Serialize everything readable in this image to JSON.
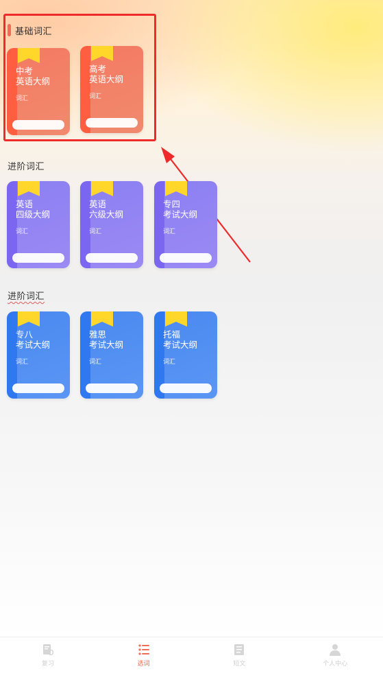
{
  "sections": [
    {
      "title": "基础词汇",
      "books": [
        {
          "name": "中考\n英语大纲",
          "sub": "词汇",
          "color": "orange"
        },
        {
          "name": "高考\n英语大纲",
          "sub": "词汇",
          "color": "orange"
        }
      ]
    },
    {
      "title": "进阶词汇",
      "books": [
        {
          "name": "英语\n四级大纲",
          "sub": "词汇",
          "color": "purple"
        },
        {
          "name": "英语\n六级大纲",
          "sub": "词汇",
          "color": "purple"
        },
        {
          "name": "专四\n考试大纲",
          "sub": "词汇",
          "color": "purple"
        }
      ]
    },
    {
      "title": "进阶词汇",
      "books": [
        {
          "name": "专八\n考试大纲",
          "sub": "词汇",
          "color": "blue"
        },
        {
          "name": "雅思\n考试大纲",
          "sub": "词汇",
          "color": "blue"
        },
        {
          "name": "托福\n考试大纲",
          "sub": "词汇",
          "color": "blue"
        }
      ]
    }
  ],
  "tabbar": {
    "items": [
      {
        "label": "复习",
        "icon": "review-icon",
        "active": false
      },
      {
        "label": "选词",
        "icon": "list-icon",
        "active": true
      },
      {
        "label": "短文",
        "icon": "article-icon",
        "active": false
      },
      {
        "label": "个人中心",
        "icon": "user-icon",
        "active": false
      }
    ]
  },
  "colors": {
    "accent": "#f26b56",
    "highlight": "#ee2a2a",
    "orange_book": "#f47a62",
    "purple_book": "#8b7ff2",
    "blue_book": "#4a89f0",
    "ribbon": "#ffd62a"
  }
}
